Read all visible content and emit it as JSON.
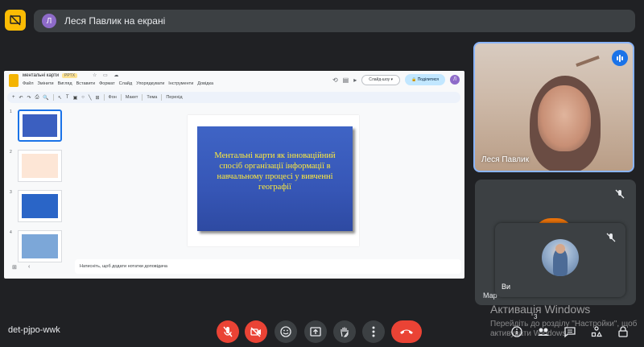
{
  "top": {
    "presenting_avatar": "Л",
    "presenting_text": "Леся Павлик на екрані"
  },
  "slides_app": {
    "doc_title": "ментальні карти",
    "badge": "PPTX",
    "menu": [
      "Файл",
      "Змінити",
      "Вигляд",
      "Вставити",
      "Формат",
      "Слайд",
      "Упорядкувати",
      "Інструменти",
      "Довідка"
    ],
    "slideshow_label": "Слайд-шоу",
    "share_label": "Поділитися",
    "user_avatar": "Л",
    "toolbar_buttons": [
      "Фон",
      "Макет",
      "Тема",
      "Перехід"
    ],
    "slide_numbers": [
      "1",
      "2",
      "3",
      "4"
    ],
    "slide_title": "Ментальні карти як інноваційний спосіб організації інформації в навчальному процесі у вивченні географії",
    "notes_placeholder": "Натисніть, щоб додати нотатки доповідача"
  },
  "participants": {
    "main_speaker": "Леся Павлик",
    "tile_partial_name": "Мар",
    "self_name": "Ви"
  },
  "windows_watermark": {
    "title": "Активація Windows",
    "subtitle": "Перейдіть до розділу \"Настройки\", щоб активувати Windows."
  },
  "bottom": {
    "meeting_code": "det-pjpo-wwk",
    "participants_count": "3"
  }
}
